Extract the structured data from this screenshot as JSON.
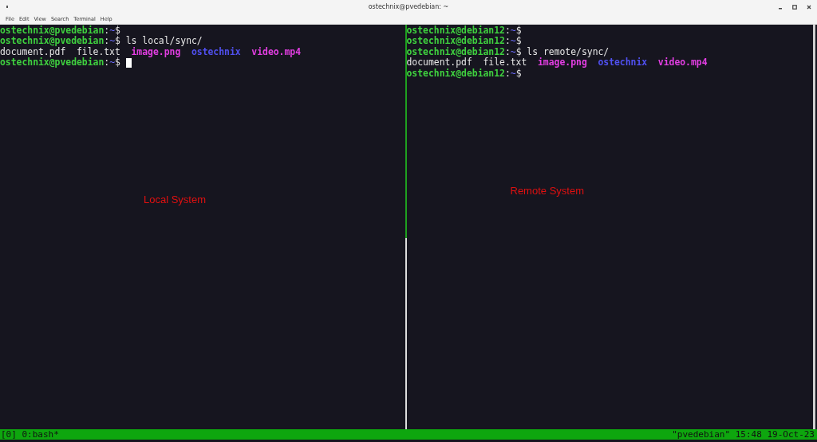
{
  "window": {
    "title": "ostechnix@pvedebian: ~"
  },
  "menu": [
    "File",
    "Edit",
    "View",
    "Search",
    "Terminal",
    "Help"
  ],
  "panes": [
    {
      "active": true,
      "annotation": "Local System",
      "lines": [
        {
          "kind": "prompt",
          "segments": [
            {
              "text": "ostechnix@pvedebian",
              "kind": "user"
            },
            {
              "text": ":",
              "kind": "plain"
            },
            {
              "text": "~",
              "kind": "path"
            },
            {
              "text": "$",
              "kind": "plain"
            }
          ]
        },
        {
          "kind": "prompt",
          "segments": [
            {
              "text": "ostechnix@pvedebian",
              "kind": "user"
            },
            {
              "text": ":",
              "kind": "plain"
            },
            {
              "text": "~",
              "kind": "path"
            },
            {
              "text": "$",
              "kind": "plain"
            },
            {
              "text": "ls local/sync/",
              "kind": "command"
            }
          ]
        },
        {
          "kind": "listing",
          "segments": [
            {
              "text": "document.pdf",
              "kind": "file"
            },
            {
              "text": "file.txt",
              "kind": "file"
            },
            {
              "text": "image.png",
              "kind": "image"
            },
            {
              "text": "ostechnix",
              "kind": "dir"
            },
            {
              "text": "video.mp4",
              "kind": "media"
            }
          ]
        },
        {
          "kind": "prompt",
          "cursor": true,
          "segments": [
            {
              "text": "ostechnix@pvedebian",
              "kind": "user"
            },
            {
              "text": ":",
              "kind": "plain"
            },
            {
              "text": "~",
              "kind": "path"
            },
            {
              "text": "$",
              "kind": "plain"
            }
          ]
        }
      ]
    },
    {
      "active": false,
      "annotation": "Remote System",
      "lines": [
        {
          "kind": "prompt",
          "segments": [
            {
              "text": "ostechnix@debian12",
              "kind": "user"
            },
            {
              "text": ":",
              "kind": "plain"
            },
            {
              "text": "~",
              "kind": "path"
            },
            {
              "text": "$",
              "kind": "plain"
            }
          ]
        },
        {
          "kind": "prompt",
          "segments": [
            {
              "text": "ostechnix@debian12",
              "kind": "user"
            },
            {
              "text": ":",
              "kind": "plain"
            },
            {
              "text": "~",
              "kind": "path"
            },
            {
              "text": "$",
              "kind": "plain"
            }
          ]
        },
        {
          "kind": "prompt",
          "segments": [
            {
              "text": "ostechnix@debian12",
              "kind": "user"
            },
            {
              "text": ":",
              "kind": "plain"
            },
            {
              "text": "~",
              "kind": "path"
            },
            {
              "text": "$",
              "kind": "plain"
            },
            {
              "text": "ls remote/sync/",
              "kind": "command"
            }
          ]
        },
        {
          "kind": "listing",
          "segments": [
            {
              "text": "document.pdf",
              "kind": "file"
            },
            {
              "text": "file.txt",
              "kind": "file"
            },
            {
              "text": "image.png",
              "kind": "image"
            },
            {
              "text": "ostechnix",
              "kind": "dir"
            },
            {
              "text": "video.mp4",
              "kind": "media"
            }
          ]
        },
        {
          "kind": "prompt",
          "segments": [
            {
              "text": "ostechnix@debian12",
              "kind": "user"
            },
            {
              "text": ":",
              "kind": "plain"
            },
            {
              "text": "~",
              "kind": "path"
            },
            {
              "text": "$",
              "kind": "plain"
            }
          ]
        }
      ]
    }
  ],
  "status_bar": {
    "left": "[0] 0:bash*",
    "right": "\"pvedebian\" 15:48 19-Oct-23"
  }
}
